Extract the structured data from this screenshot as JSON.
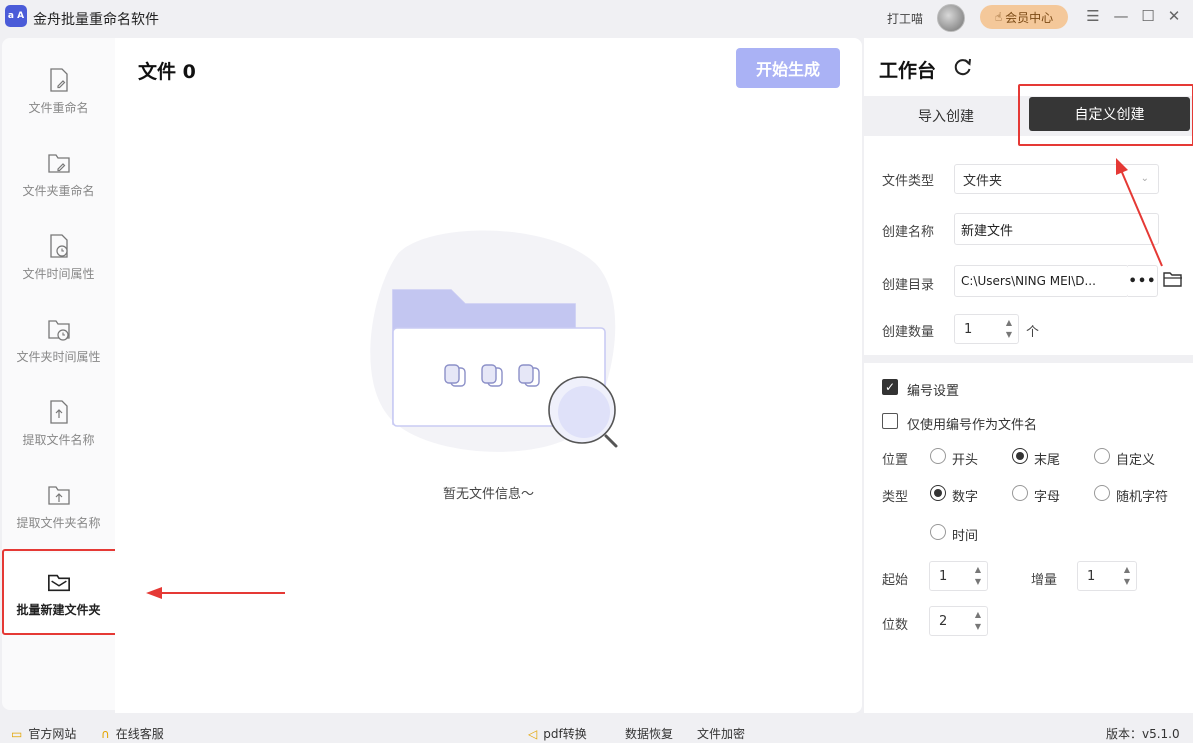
{
  "window": {
    "title": "金舟批量重命名软件",
    "logo_text": "a A",
    "user_name": "打工喵",
    "vip_label": "会员中心"
  },
  "sidebar": {
    "items": [
      {
        "label": "文件重命名",
        "icon": "file-edit-icon"
      },
      {
        "label": "文件夹重命名",
        "icon": "folder-edit-icon"
      },
      {
        "label": "文件时间属性",
        "icon": "file-clock-icon"
      },
      {
        "label": "文件夹时间属性",
        "icon": "folder-clock-icon"
      },
      {
        "label": "提取文件名称",
        "icon": "file-extract-icon"
      },
      {
        "label": "提取文件夹名称",
        "icon": "folder-extract-icon"
      },
      {
        "label": "批量新建文件夹",
        "icon": "folder-create-icon"
      }
    ]
  },
  "main": {
    "file_count_title": "文件 0",
    "start_button": "开始生成",
    "empty_text": "暂无文件信息～"
  },
  "panel": {
    "title": "工作台",
    "tabs": [
      {
        "label": "导入创建",
        "active": false
      },
      {
        "label": "自定义创建",
        "active": true
      }
    ],
    "file_type": {
      "label": "文件类型",
      "value": "文件夹"
    },
    "create_name": {
      "label": "创建名称",
      "value": "新建文件"
    },
    "create_dir": {
      "label": "创建目录",
      "value": "C:\\Users\\NING MEI\\D...",
      "more": "•••"
    },
    "create_count": {
      "label": "创建数量",
      "value": "1",
      "unit": "个"
    },
    "numbering": {
      "enable_label": "编号设置",
      "enable_checked": true,
      "only_number_label": "仅使用编号作为文件名",
      "only_number_checked": false,
      "position": {
        "label": "位置",
        "options": [
          "开头",
          "末尾",
          "自定义"
        ],
        "selected": "末尾"
      },
      "type": {
        "label": "类型",
        "options": [
          "数字",
          "字母",
          "随机字符",
          "时间"
        ],
        "selected": "数字"
      },
      "start": {
        "label": "起始",
        "value": "1"
      },
      "increment": {
        "label": "增量",
        "value": "1"
      },
      "digits": {
        "label": "位数",
        "value": "2"
      }
    }
  },
  "bottombar": {
    "website": "官方网站",
    "support": "在线客服",
    "pdf": "pdf转换",
    "recovery": "数据恢复",
    "encrypt": "文件加密",
    "version": "版本：v5.1.0"
  },
  "colors": {
    "accent_disabled": "#aab2f5",
    "highlight_red": "#e53935",
    "tab_active_bg": "#363636",
    "vip_bg": "#f4c89a"
  }
}
